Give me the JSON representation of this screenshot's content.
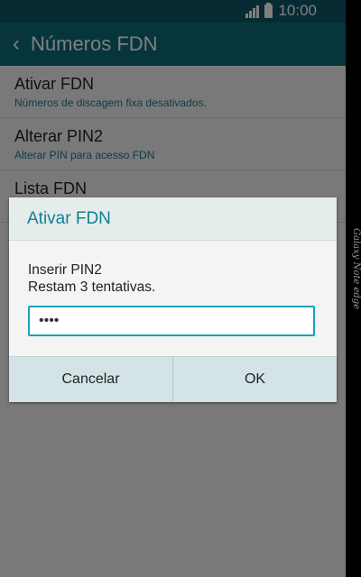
{
  "status_bar": {
    "time": "10:00",
    "icons": [
      "signal-icon",
      "battery-icon"
    ]
  },
  "app_bar": {
    "back_icon": "back-chevron",
    "title": "Números FDN"
  },
  "settings_list": [
    {
      "title": "Ativar FDN",
      "subtitle": "Números de discagem fixa desativados."
    },
    {
      "title": "Alterar PIN2",
      "subtitle": "Alterar PIN para acesso FDN"
    },
    {
      "title": "Lista FDN",
      "subtitle": ""
    }
  ],
  "dialog": {
    "title": "Ativar FDN",
    "message_line1": "Inserir PIN2",
    "message_line2": "Restam 3 tentativas.",
    "pin_value": "••••",
    "cancel_label": "Cancelar",
    "ok_label": "OK"
  },
  "device_brand": "Galaxy Note edge",
  "colors": {
    "app_bar": "#0e6a79",
    "accent": "#137f93",
    "input_border": "#19a2be"
  }
}
